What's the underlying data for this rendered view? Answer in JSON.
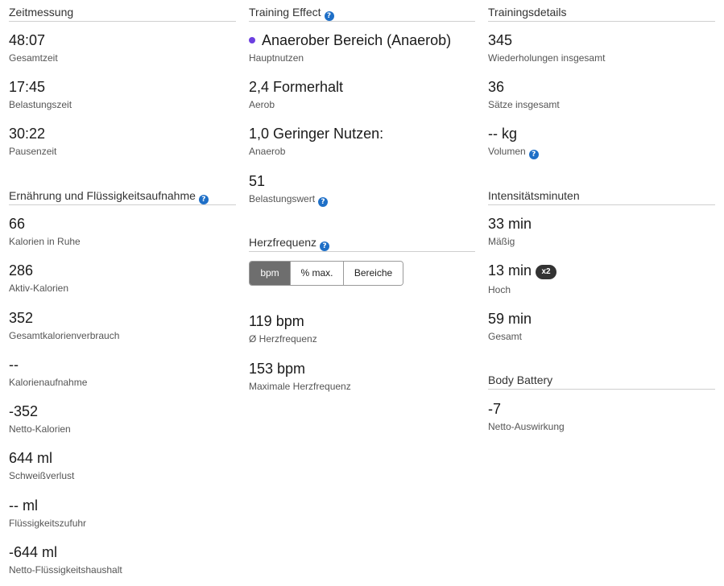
{
  "timing": {
    "title": "Zeitmessung",
    "items": [
      {
        "value": "48:07",
        "label": "Gesamtzeit"
      },
      {
        "value": "17:45",
        "label": "Belastungszeit"
      },
      {
        "value": "30:22",
        "label": "Pausenzeit"
      }
    ]
  },
  "nutrition": {
    "title": "Ernährung und Flüssigkeitsaufnahme",
    "items": [
      {
        "value": "66",
        "label": "Kalorien in Ruhe"
      },
      {
        "value": "286",
        "label": "Aktiv-Kalorien"
      },
      {
        "value": "352",
        "label": "Gesamtkalorienverbrauch"
      },
      {
        "value": "--",
        "label": "Kalorienaufnahme"
      },
      {
        "value": "-352",
        "label": "Netto-Kalorien"
      },
      {
        "value": "644 ml",
        "label": "Schweißverlust"
      },
      {
        "value": "-- ml",
        "label": "Flüssigkeitszufuhr"
      },
      {
        "value": "-644 ml",
        "label": "Netto-Flüssigkeitshaushalt"
      }
    ]
  },
  "training_effect": {
    "title": "Training Effect",
    "dot_color": "#6c3fe0",
    "items": [
      {
        "value": "Anaerober Bereich (Anaerob)",
        "label": "Hauptnutzen"
      },
      {
        "value": "2,4 Formerhalt",
        "label": "Aerob"
      },
      {
        "value": "1,0 Geringer Nutzen:",
        "label": "Anaerob"
      },
      {
        "value": "51",
        "label": "Belastungswert"
      }
    ]
  },
  "heart_rate": {
    "title": "Herzfrequenz",
    "tabs": [
      "bpm",
      "% max.",
      "Bereiche"
    ],
    "active_tab": "bpm",
    "items": [
      {
        "value": "119 bpm",
        "label": "Ø Herzfrequenz"
      },
      {
        "value": "153 bpm",
        "label": "Maximale Herzfrequenz"
      }
    ]
  },
  "training_details": {
    "title": "Trainingsdetails",
    "items": [
      {
        "value": "345",
        "label": "Wiederholungen insgesamt"
      },
      {
        "value": "36",
        "label": "Sätze insgesamt"
      },
      {
        "value": "-- kg",
        "label": "Volumen"
      }
    ]
  },
  "intensity": {
    "title": "Intensitätsminuten",
    "items": [
      {
        "value": "33 min",
        "label": "Mäßig"
      },
      {
        "value": "13 min",
        "label": "Hoch",
        "badge": "x2"
      },
      {
        "value": "59 min",
        "label": "Gesamt"
      }
    ]
  },
  "body_battery": {
    "title": "Body Battery",
    "items": [
      {
        "value": "-7",
        "label": "Netto-Auswirkung"
      }
    ]
  },
  "help_icon_glyph": "?",
  "colors": {
    "help": "#1e6fc7",
    "active_tab": "#6e6e6e",
    "badge": "#333333"
  }
}
